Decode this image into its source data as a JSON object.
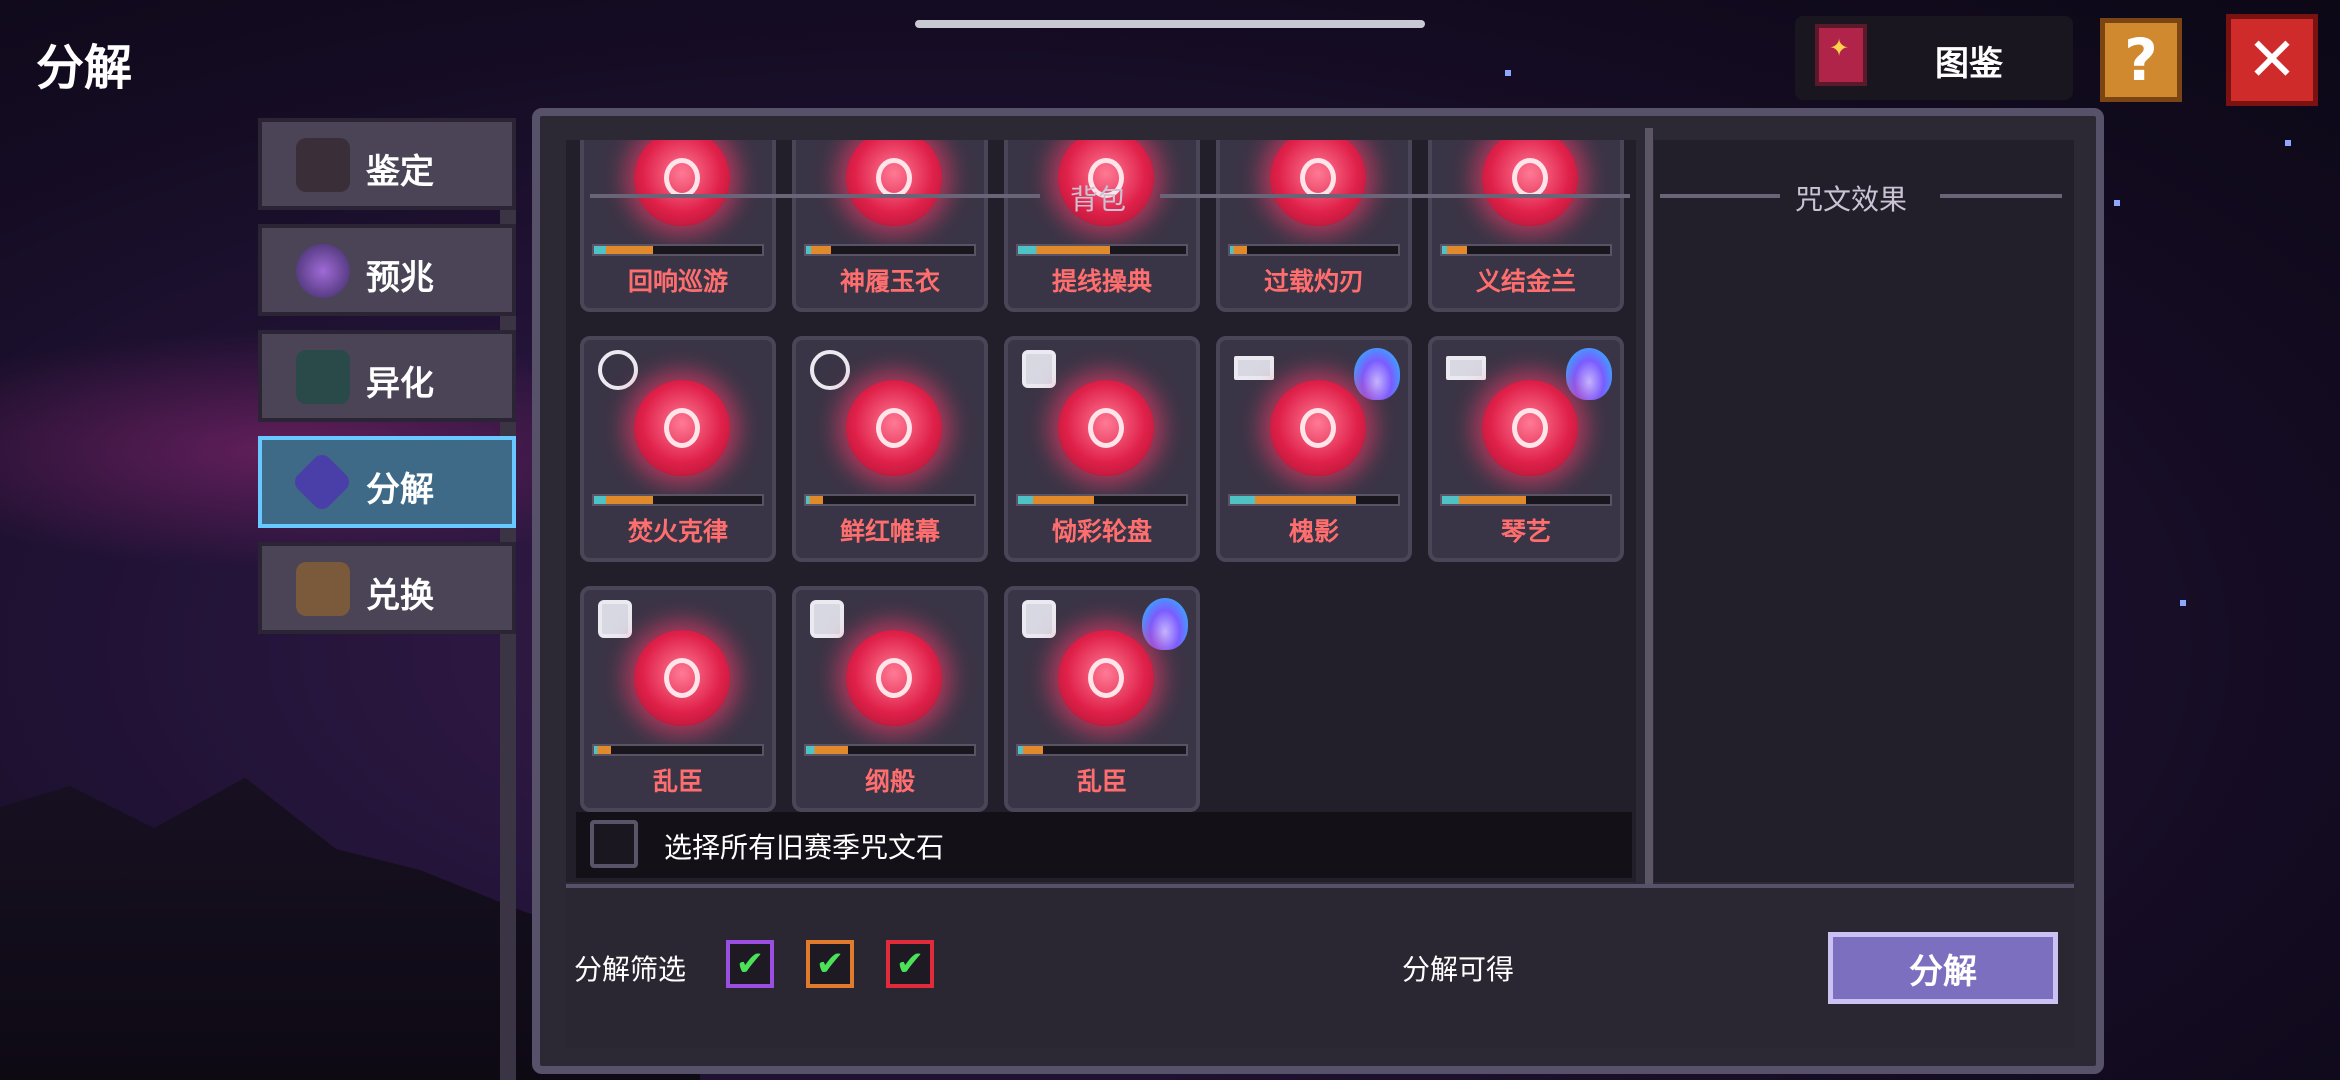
{
  "page": {
    "title": "分解"
  },
  "top_bar": {
    "codex_label": "图鉴",
    "help_symbol": "?",
    "close_symbol": "✕"
  },
  "sidebar": {
    "items": [
      {
        "label": "鉴定",
        "icon": "appraise-icon",
        "active": false
      },
      {
        "label": "预兆",
        "icon": "omen-orb-icon",
        "active": false
      },
      {
        "label": "异化",
        "icon": "mutation-icon",
        "active": false
      },
      {
        "label": "分解",
        "icon": "decompose-crystal-icon",
        "active": true
      },
      {
        "label": "兑换",
        "icon": "exchange-chest-icon",
        "active": false
      }
    ]
  },
  "inventory": {
    "title": "背包",
    "runes": [
      {
        "name": "回响巡游",
        "progress": 0.35,
        "type": "none",
        "flame": false
      },
      {
        "name": "神履玉衣",
        "progress": 0.15,
        "type": "none",
        "flame": false
      },
      {
        "name": "提线操典",
        "progress": 0.55,
        "type": "none",
        "flame": false
      },
      {
        "name": "过载灼刃",
        "progress": 0.1,
        "type": "none",
        "flame": false
      },
      {
        "name": "义结金兰",
        "progress": 0.15,
        "type": "none",
        "flame": false
      },
      {
        "name": "焚火克律",
        "progress": 0.35,
        "type": "ring",
        "flame": false
      },
      {
        "name": "鲜红帷幕",
        "progress": 0.1,
        "type": "ring",
        "flame": false
      },
      {
        "name": "恸彩轮盘",
        "progress": 0.45,
        "type": "armor",
        "flame": false
      },
      {
        "name": "槐影",
        "progress": 0.75,
        "type": "sword",
        "flame": true
      },
      {
        "name": "琴艺",
        "progress": 0.5,
        "type": "sword",
        "flame": true
      },
      {
        "name": "乱臣",
        "progress": 0.1,
        "type": "armor",
        "flame": false
      },
      {
        "name": "纲般",
        "progress": 0.25,
        "type": "armor",
        "flame": false
      },
      {
        "name": "乱臣",
        "progress": 0.15,
        "type": "armor",
        "flame": true
      }
    ],
    "select_all_label": "选择所有旧赛季咒文石"
  },
  "effect_panel": {
    "title": "咒文效果"
  },
  "bottom": {
    "filter_label": "分解筛选",
    "filters": [
      {
        "color": "#9a4fe0",
        "checked": true
      },
      {
        "color": "#e07a2c",
        "checked": true
      },
      {
        "color": "#e02b3a",
        "checked": true
      }
    ],
    "check_mark": "✔",
    "yield_label": "分解可得",
    "decompose_button": "分解"
  }
}
